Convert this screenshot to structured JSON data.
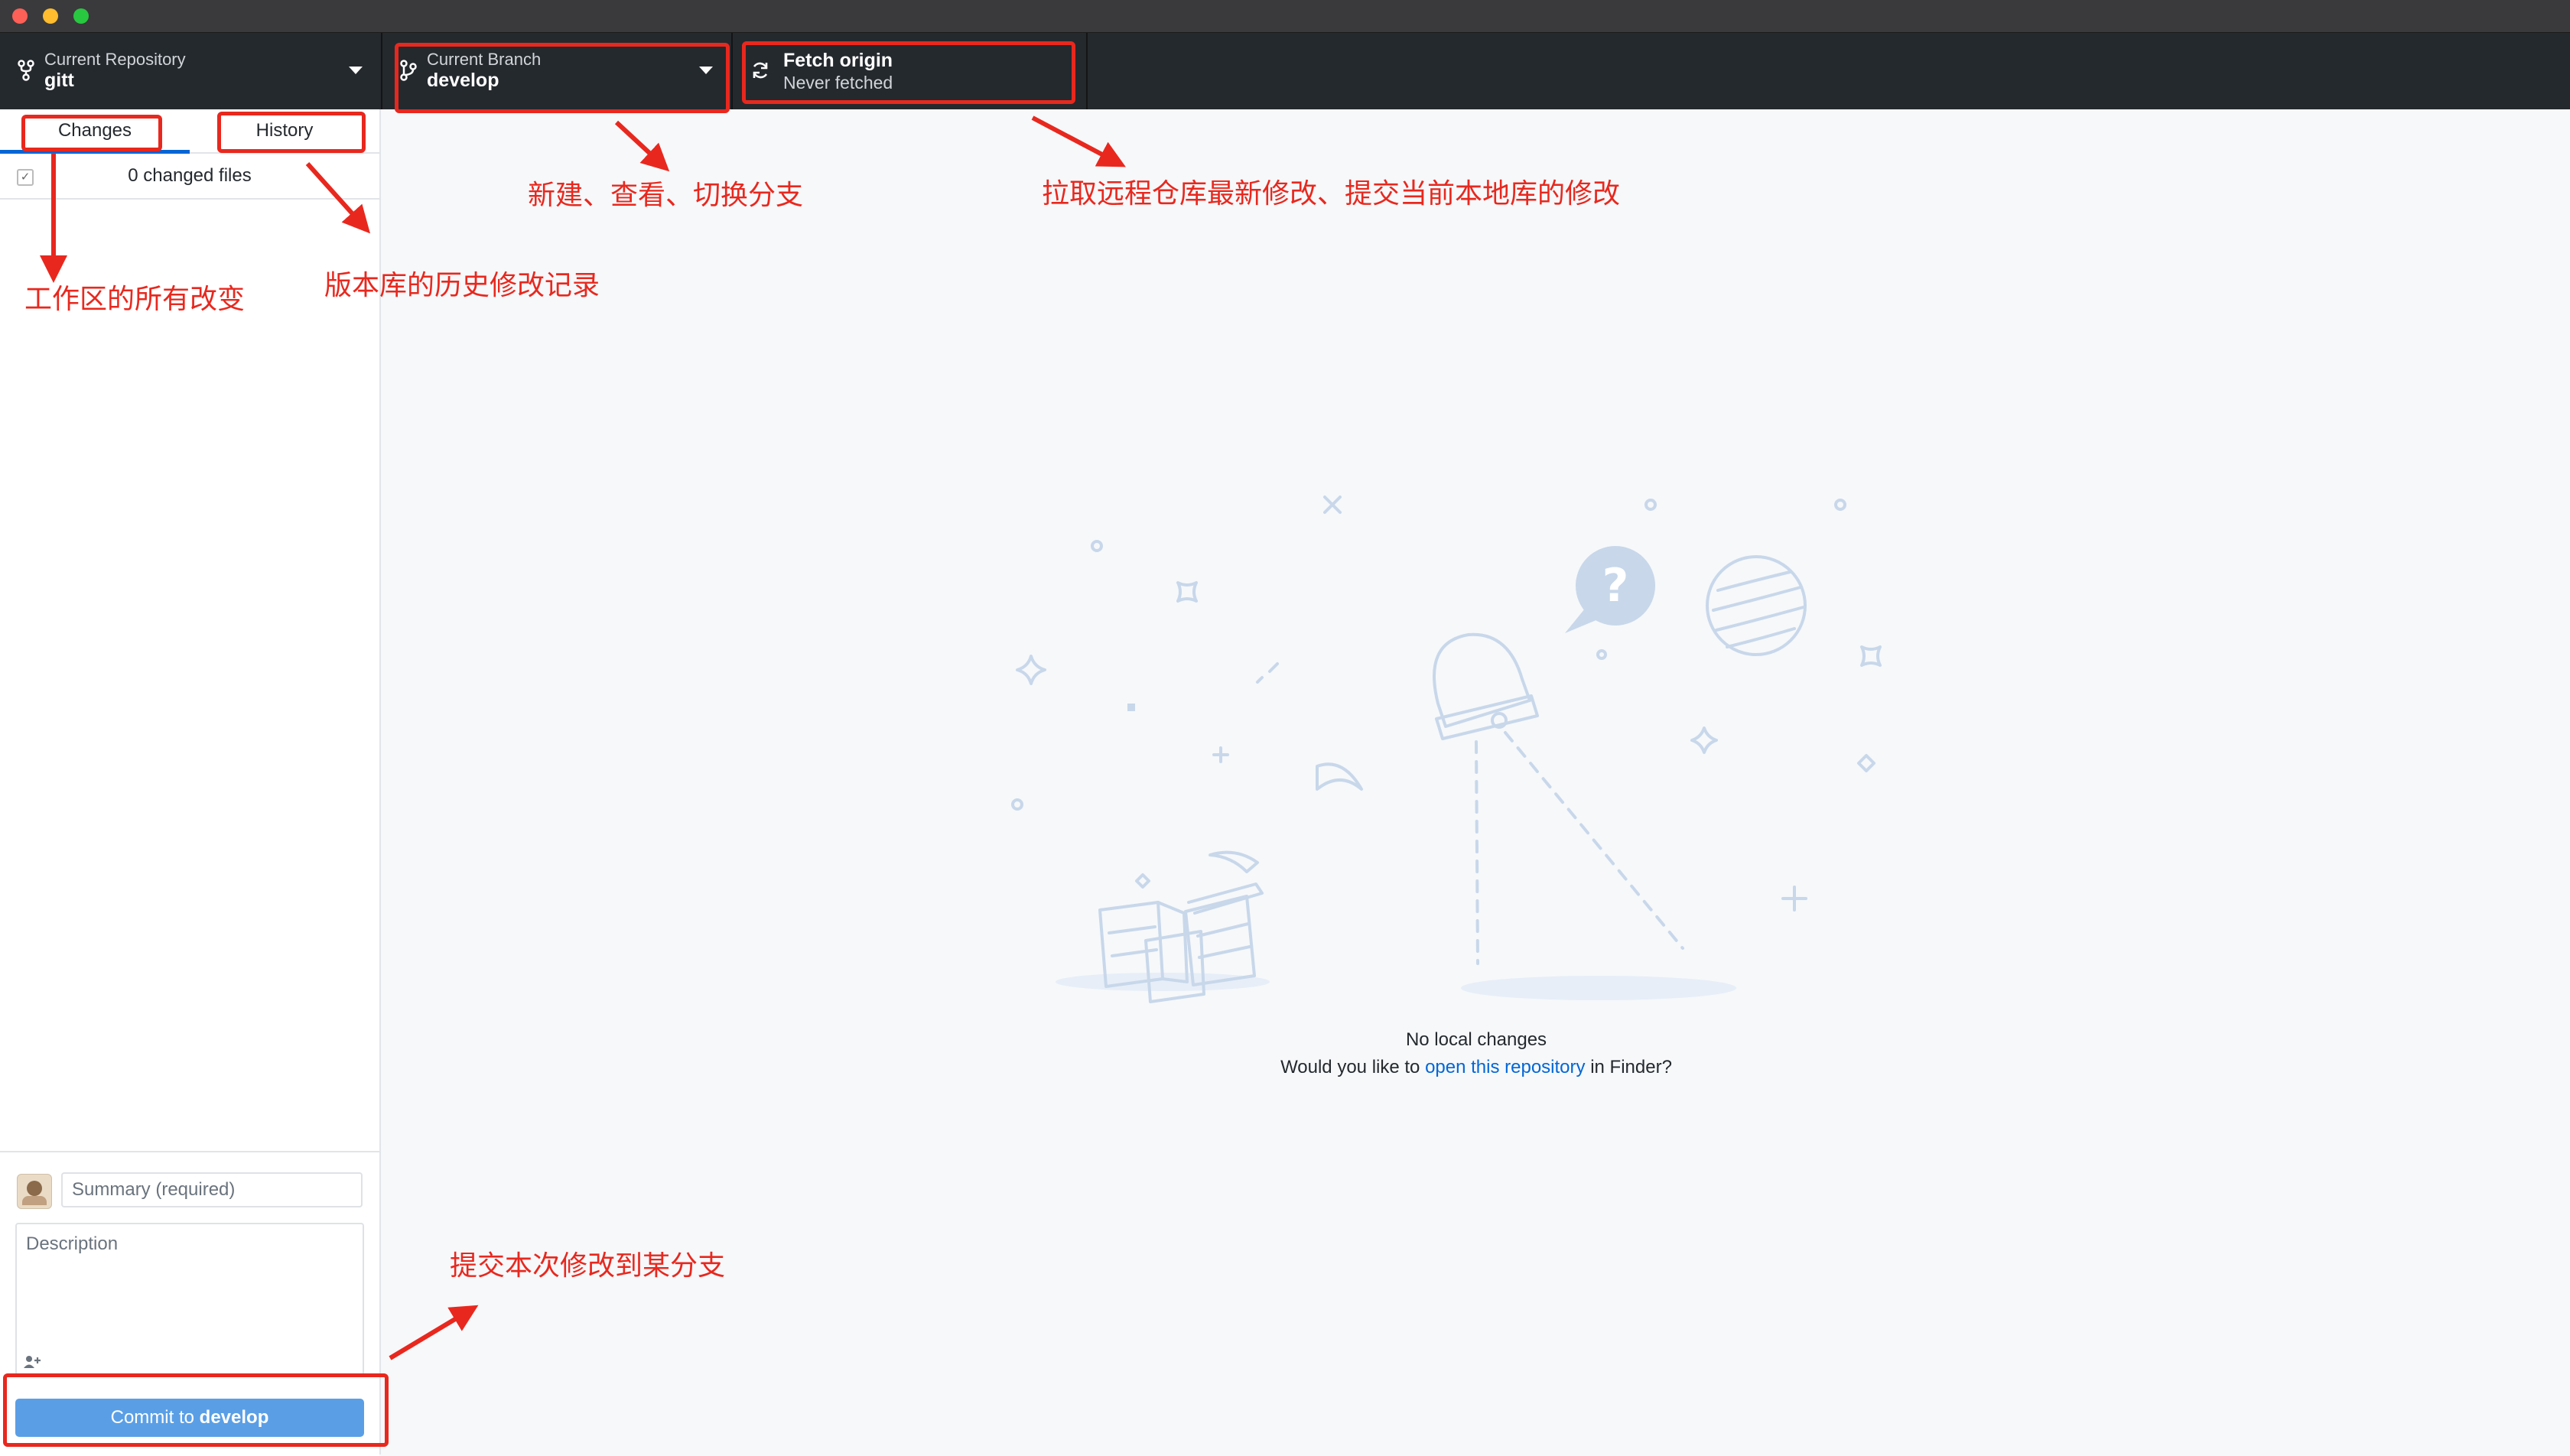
{
  "toolbar": {
    "repo_label": "Current Repository",
    "repo_value": "gitt",
    "branch_label": "Current Branch",
    "branch_value": "develop",
    "fetch_label": "Fetch origin",
    "fetch_status": "Never fetched"
  },
  "sidebar": {
    "tabs": [
      {
        "label": "Changes",
        "active": true
      },
      {
        "label": "History",
        "active": false
      }
    ],
    "changed_files": "0 changed files"
  },
  "commit": {
    "summary_placeholder": "Summary (required)",
    "description_placeholder": "Description",
    "button_prefix": "Commit to",
    "button_branch": "develop"
  },
  "main": {
    "no_changes_title": "No local changes",
    "open_prompt_before": "Would you like to",
    "open_link": "open this repository",
    "open_prompt_after": "in Finder?"
  },
  "annotations": {
    "branch_note": "新建、查看、切换分支",
    "fetch_note": "拉取远程仓库最新修改、提交当前本地库的修改",
    "changes_note": "工作区的所有改变",
    "history_note": "版本库的历史修改记录",
    "commit_note": "提交本次修改到某分支"
  },
  "colors": {
    "annotation": "#e8281e",
    "toolbar_bg": "#24292e",
    "accent": "#0366d6",
    "commit_button": "#5a9fe6"
  }
}
